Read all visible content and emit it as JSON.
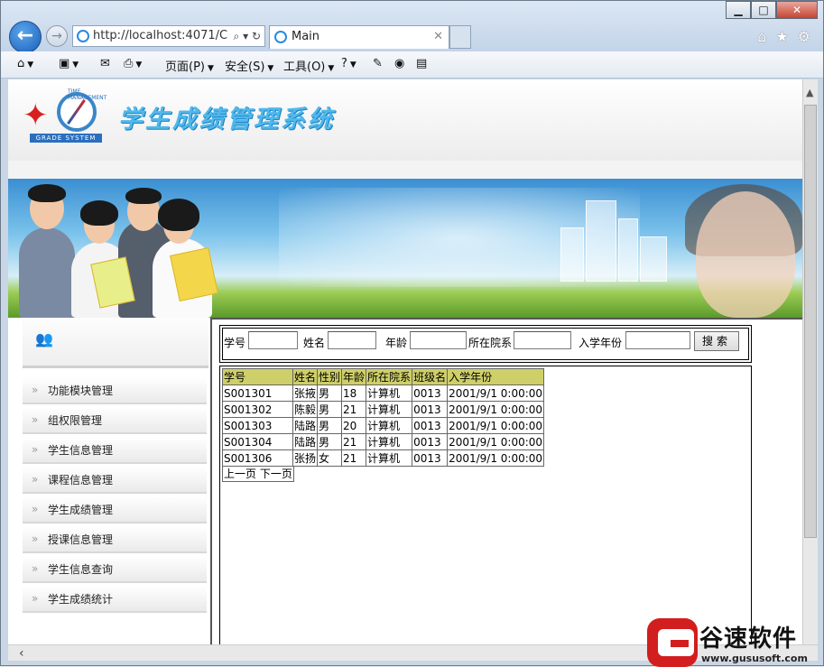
{
  "browser": {
    "address": "http://localhost:4071/C",
    "tab_title": "Main",
    "window_buttons": {
      "minimize": "▁",
      "maximize": "□",
      "close": "✕"
    },
    "commands": [
      {
        "label": "",
        "icon": "home-icon"
      },
      {
        "label": "",
        "icon": "rss-icon"
      },
      {
        "label": "",
        "icon": "mail-icon"
      },
      {
        "label": "",
        "icon": "print-icon"
      },
      {
        "label": "页面(P)"
      },
      {
        "label": "安全(S)"
      },
      {
        "label": "工具(O)"
      },
      {
        "label": "",
        "icon": "help-icon"
      }
    ],
    "right_icons": [
      "home-icon",
      "star-icon",
      "gear-icon"
    ]
  },
  "header": {
    "title": "学生成绩管理系统",
    "logo_text": "GRADE SYSTEM",
    "logo_top": "TIME MANAGEMENT"
  },
  "sidebar": {
    "items": [
      {
        "label": "功能模块管理"
      },
      {
        "label": "组权限管理"
      },
      {
        "label": "学生信息管理"
      },
      {
        "label": "课程信息管理"
      },
      {
        "label": "学生成绩管理"
      },
      {
        "label": "授课信息管理"
      },
      {
        "label": "学生信息查询"
      },
      {
        "label": "学生成绩统计"
      }
    ]
  },
  "search": {
    "fields": [
      {
        "label": "学号",
        "value": ""
      },
      {
        "label": "姓名",
        "value": ""
      },
      {
        "label": "年龄",
        "value": ""
      },
      {
        "label": "所在院系",
        "value": ""
      },
      {
        "label": "入学年份",
        "value": ""
      }
    ],
    "button": "搜索"
  },
  "table": {
    "columns": [
      "学号",
      "姓名",
      "性别",
      "年龄",
      "所在院系",
      "班级名",
      "入学年份"
    ],
    "rows": [
      [
        "S001301",
        "张掖",
        "男",
        "18",
        "计算机",
        "0013",
        "2001/9/1 0:00:00"
      ],
      [
        "S001302",
        "陈毅",
        "男",
        "21",
        "计算机",
        "0013",
        "2001/9/1 0:00:00"
      ],
      [
        "S001303",
        "陆路",
        "男",
        "20",
        "计算机",
        "0013",
        "2001/9/1 0:00:00"
      ],
      [
        "S001304",
        "陆路",
        "男",
        "21",
        "计算机",
        "0013",
        "2001/9/1 0:00:00"
      ],
      [
        "S001306",
        "张扬",
        "女",
        "21",
        "计算机",
        "0013",
        "2001/9/1 0:00:00"
      ]
    ],
    "pager": {
      "prev": "上一页",
      "next": "下一页"
    }
  },
  "watermark": {
    "brand": "谷速软件",
    "url": "www.gususoft.com"
  },
  "colors": {
    "title": "#4fb8ec",
    "header_row": "#cfcf6a"
  }
}
